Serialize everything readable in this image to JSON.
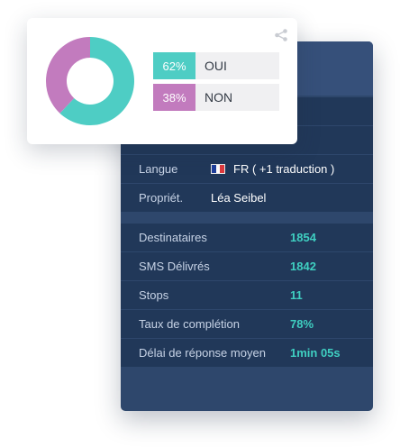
{
  "colors": {
    "yes": "#4ecdc4",
    "no": "#c27bbe",
    "stat_accent": "#3fcfc1"
  },
  "poll": {
    "share_icon": "share-icon",
    "chart_data": {
      "type": "pie",
      "categories": [
        "OUI",
        "NON"
      ],
      "values": [
        62,
        38
      ],
      "donut": true
    },
    "answers": [
      {
        "percent": "62%",
        "label": "OUI"
      },
      {
        "percent": "38%",
        "label": "NON"
      }
    ]
  },
  "details": {
    "language_label": "Langue",
    "language_flag": "france-flag-icon",
    "language_value": "FR ( +1 traduction )",
    "owner_label": "Propriét.",
    "owner_value": "Léa Seibel"
  },
  "stats": [
    {
      "label": "Destinataires",
      "value": "1854"
    },
    {
      "label": "SMS Délivrés",
      "value": "1842"
    },
    {
      "label": "Stops",
      "value": "11"
    },
    {
      "label": "Taux de complétion",
      "value": "78%"
    },
    {
      "label": "Délai de réponse moyen",
      "value": "1min 05s"
    }
  ]
}
